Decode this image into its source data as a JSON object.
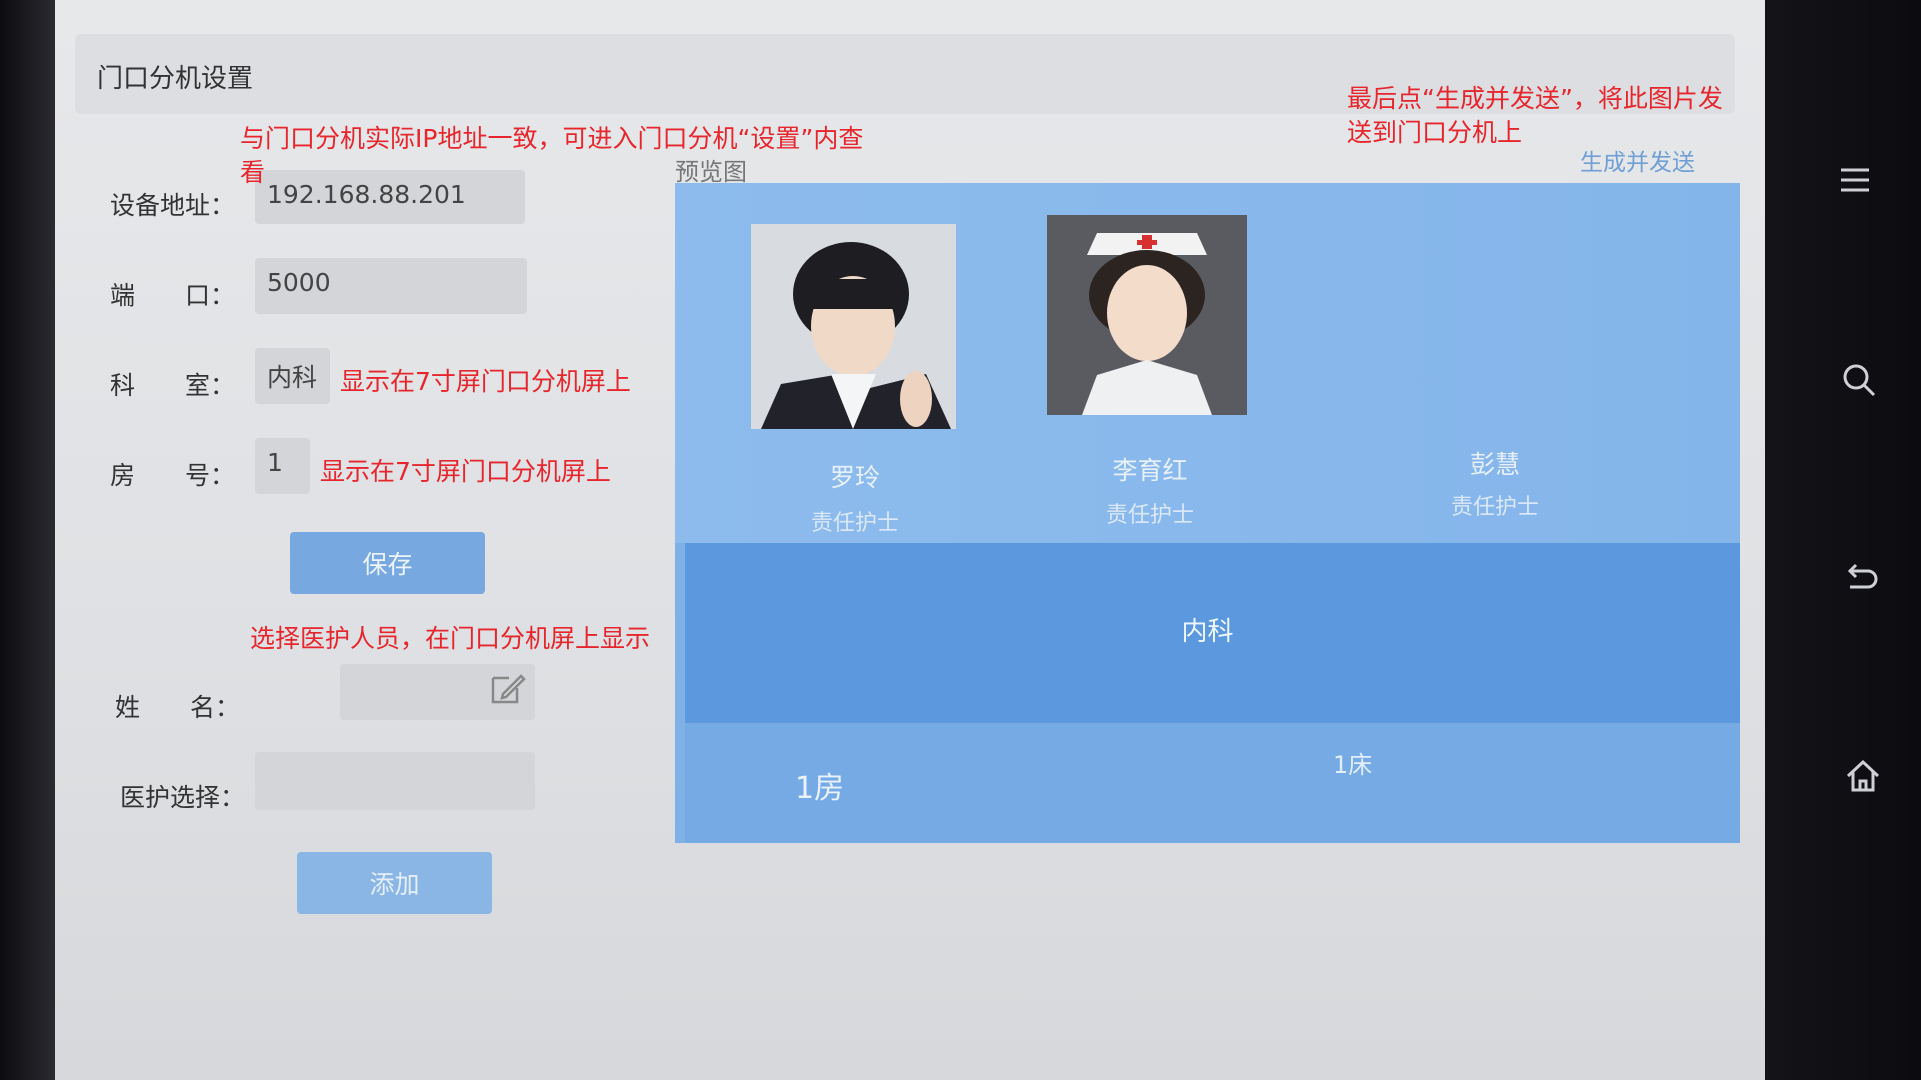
{
  "window": {
    "title": "门口分机设置"
  },
  "form": {
    "device_address_label": "设备地址：",
    "device_address_value": "192.168.88.201",
    "port_label": "端　　口：",
    "port_value": "5000",
    "department_label": "科　　室：",
    "department_value": "内科",
    "room_label": "房　　号：",
    "room_value": "1",
    "save_label": "保存",
    "name_label": "姓　　名：",
    "name_value": "",
    "staff_select_label": "医护选择：",
    "staff_select_value": "",
    "add_label": "添加"
  },
  "preview": {
    "label": "预览图",
    "generate_send_label": "生成并发送",
    "nurses": [
      {
        "name": "罗玲",
        "role": "责任护士"
      },
      {
        "name": "李育红",
        "role": "责任护士"
      },
      {
        "name": "彭慧",
        "role": "责任护士"
      }
    ],
    "department": "内科",
    "room": "1房",
    "bed": "1床"
  },
  "annotations": {
    "ip_note": "与门口分机实际IP地址一致，可进入门口分机“设置”内查看",
    "dept_note": "显示在7寸屏门口分机屏上",
    "room_note": "显示在7寸屏门口分机屏上",
    "staff_note": "选择医护人员，在门口分机屏上显示",
    "send_note": "最后点“生成并发送”，将此图片发送到门口分机上"
  },
  "nav": {
    "icons": [
      "menu-icon",
      "search-icon",
      "back-icon",
      "home-icon"
    ]
  },
  "colors": {
    "accent": "#77a8e0",
    "annotation": "#e6262c",
    "preview_bg": "#7fb1e6",
    "dept_band": "#5b98de"
  }
}
